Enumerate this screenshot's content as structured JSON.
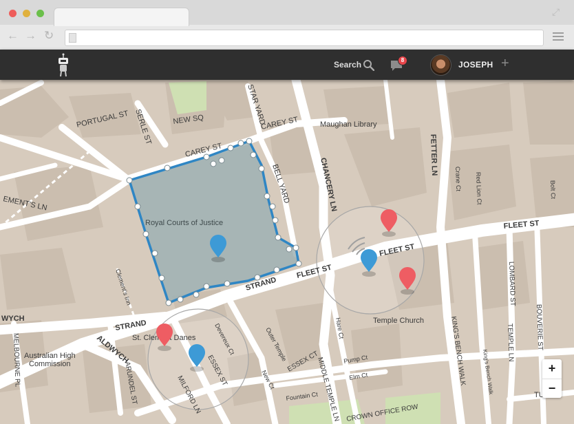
{
  "header": {
    "search_label": "Search",
    "notification_count": "8",
    "username": "JOSEPH",
    "add_label": "+"
  },
  "map": {
    "zoom_in": "+",
    "zoom_out": "−",
    "places": {
      "royal_courts": "Royal Courts of Justice",
      "maughan_library": "Maughan Library",
      "temple_church": "Temple Church",
      "st_clement_danes": "St. Clement Danes",
      "australian_high_commission_1": "Australian High",
      "australian_high_commission_2": "Commission"
    },
    "streets": {
      "portugal_st": "PORTUGAL ST",
      "serle_st": "SERLE ST",
      "new_sq": "NEW SQ",
      "star_yard": "STAR YARD",
      "carey_st_1": "CAREY ST",
      "carey_st_2": "CAREY ST",
      "bell_yard": "BELL YARD",
      "chancery_ln": "CHANCERY LN",
      "fetter_ln": "FETTER LN",
      "crane_ct": "Crane Ct",
      "red_lion_ct": "Red Lion Ct",
      "bolt_ct": "Bolt Ct",
      "fleet_st_1": "FLEET ST",
      "fleet_st_2": "FLEET ST",
      "fleet_st_3": "FLEET ST",
      "strand_1": "STRAND",
      "strand_2": "STRAND",
      "clements_inn": "Clement's Inn",
      "clements_ln": "EMENT'S LN",
      "aldwych_1": "WYCH",
      "aldwych_2": "ALDWYCH",
      "melbourne_pl": "MELBOURNE PL",
      "arundel_st": "ARUNDEL ST",
      "milford_ln": "MILFORD LN",
      "essex_st": "ESSEX ST",
      "essex_ct": "ESSEX CT",
      "devereux_ct": "Devereux Ct",
      "outer_temple": "Outer Temple",
      "new_ct": "New Ct",
      "hare_ct": "Hare Ct",
      "pump_ct": "Pump Ct",
      "elm_ct": "Elm Ct",
      "fountain_ct": "Fountain Ct",
      "middle_temple_ln": "MIDDLE TEMPLE LN",
      "crown_office_row": "CROWN OFFICE ROW",
      "kings_bench_walk_1": "KING'S BENCH WALK",
      "kings_bench_walk_2": "King's Bench Walk",
      "lombard_st": "LOMBARD ST",
      "temple_ln": "TEMPLE LN",
      "bouverie_st": "BOUVERIE ST",
      "tudor_st": "TU"
    },
    "colors": {
      "land": "#d7cbbd",
      "road": "#ffffff",
      "park": "#cfe0b3",
      "zone_fill": "#9fb1b4",
      "zone_stroke": "#2f86c4",
      "pin_blue": "#3d9ad6",
      "pin_red": "#ee5d63"
    }
  }
}
